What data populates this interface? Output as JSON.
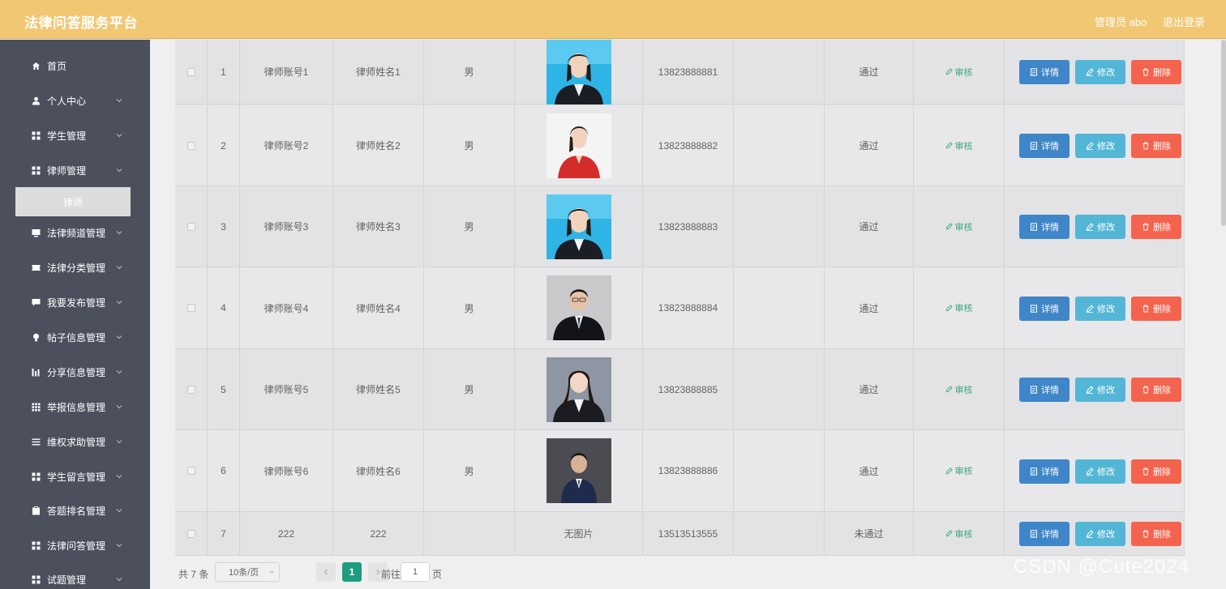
{
  "header": {
    "brand": "法律问答服务平台",
    "admin_label": "管理员 abo",
    "logout_label": "退出登录"
  },
  "sidebar": {
    "items": [
      {
        "label": "首页",
        "icon": "home-icon",
        "has_chevron": false
      },
      {
        "label": "个人中心",
        "icon": "user-icon",
        "has_chevron": true
      },
      {
        "label": "学生管理",
        "icon": "grid-icon",
        "has_chevron": true
      },
      {
        "label": "律师管理",
        "icon": "grid-icon",
        "has_chevron": true
      },
      {
        "label": "法律频道管理",
        "icon": "monitor-icon",
        "has_chevron": true
      },
      {
        "label": "法律分类管理",
        "icon": "ticket-icon",
        "has_chevron": true
      },
      {
        "label": "我要发布管理",
        "icon": "chat-icon",
        "has_chevron": true
      },
      {
        "label": "帖子信息管理",
        "icon": "bulb-icon",
        "has_chevron": true
      },
      {
        "label": "分享信息管理",
        "icon": "chart-icon",
        "has_chevron": true
      },
      {
        "label": "举报信息管理",
        "icon": "apps-icon",
        "has_chevron": true
      },
      {
        "label": "维权求助管理",
        "icon": "list-icon",
        "has_chevron": true
      },
      {
        "label": "学生留言管理",
        "icon": "grid-icon",
        "has_chevron": true
      },
      {
        "label": "答题排名管理",
        "icon": "clipboard-icon",
        "has_chevron": true
      },
      {
        "label": "法律问答管理",
        "icon": "grid-icon",
        "has_chevron": true
      },
      {
        "label": "试题管理",
        "icon": "grid-icon",
        "has_chevron": true
      }
    ],
    "active_sub": "律师"
  },
  "table": {
    "rows": [
      {
        "index": "1",
        "account": "律师账号1",
        "name": "律师姓名1",
        "gender": "男",
        "photo": "female-suit-blue",
        "phone": "13823888881",
        "status": "通过"
      },
      {
        "index": "2",
        "account": "律师账号2",
        "name": "律师姓名2",
        "gender": "男",
        "photo": "female-red-white",
        "phone": "13823888882",
        "status": "通过"
      },
      {
        "index": "3",
        "account": "律师账号3",
        "name": "律师姓名3",
        "gender": "男",
        "photo": "female-suit-blue",
        "phone": "13823888883",
        "status": "通过"
      },
      {
        "index": "4",
        "account": "律师账号4",
        "name": "律师姓名4",
        "gender": "男",
        "photo": "male-suit-dark",
        "phone": "13823888884",
        "status": "通过"
      },
      {
        "index": "5",
        "account": "律师账号5",
        "name": "律师姓名5",
        "gender": "男",
        "photo": "female-suit-gray",
        "phone": "13823888885",
        "status": "通过"
      },
      {
        "index": "6",
        "account": "律师账号6",
        "name": "律师姓名6",
        "gender": "男",
        "photo": "male-suit-gray",
        "phone": "13823888886",
        "status": "通过"
      },
      {
        "index": "7",
        "account": "222",
        "name": "222",
        "gender": "",
        "photo_text": "无图片",
        "phone": "13513513555",
        "status": "未通过"
      }
    ],
    "audit_label": "审核",
    "detail_label": "详情",
    "edit_label": "修改",
    "delete_label": "删除"
  },
  "pagination": {
    "total_text": "共 7 条",
    "page_size": "10条/页",
    "current_page": "1",
    "goto_label": "前往",
    "goto_value": "1",
    "page_suffix": "页"
  },
  "watermark": "CSDN @Cute2024",
  "colors": {
    "header": "#f2c774",
    "sidebar": "#4c505d",
    "detail": "#3f86c9",
    "edit": "#54b6d6",
    "delete": "#f4634e",
    "audit": "#3aa77f",
    "current_page": "#1f9c7f"
  }
}
